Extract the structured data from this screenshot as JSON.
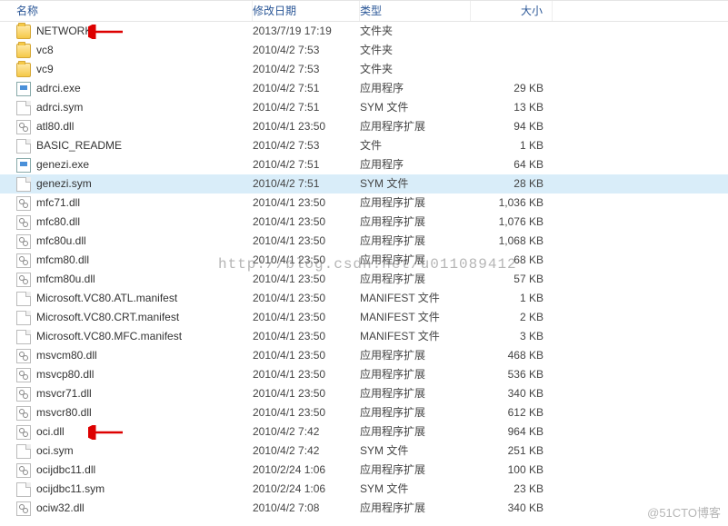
{
  "columns": {
    "name": "名称",
    "date": "修改日期",
    "type": "类型",
    "size": "大小"
  },
  "watermark_center": "http://blog.csdn.net/u011089412",
  "watermark_corner": "@51CTO博客",
  "files": [
    {
      "name": "NETWORK",
      "date": "2013/7/19 17:19",
      "type": "文件夹",
      "size": "",
      "icon": "folder",
      "annotated": true
    },
    {
      "name": "vc8",
      "date": "2010/4/2 7:53",
      "type": "文件夹",
      "size": "",
      "icon": "folder"
    },
    {
      "name": "vc9",
      "date": "2010/4/2 7:53",
      "type": "文件夹",
      "size": "",
      "icon": "folder"
    },
    {
      "name": "adrci.exe",
      "date": "2010/4/2 7:51",
      "type": "应用程序",
      "size": "29 KB",
      "icon": "exe"
    },
    {
      "name": "adrci.sym",
      "date": "2010/4/2 7:51",
      "type": "SYM 文件",
      "size": "13 KB",
      "icon": "file"
    },
    {
      "name": "atl80.dll",
      "date": "2010/4/1 23:50",
      "type": "应用程序扩展",
      "size": "94 KB",
      "icon": "dll"
    },
    {
      "name": "BASIC_README",
      "date": "2010/4/2 7:53",
      "type": "文件",
      "size": "1 KB",
      "icon": "file"
    },
    {
      "name": "genezi.exe",
      "date": "2010/4/2 7:51",
      "type": "应用程序",
      "size": "64 KB",
      "icon": "exe"
    },
    {
      "name": "genezi.sym",
      "date": "2010/4/2 7:51",
      "type": "SYM 文件",
      "size": "28 KB",
      "icon": "file",
      "selected": true
    },
    {
      "name": "mfc71.dll",
      "date": "2010/4/1 23:50",
      "type": "应用程序扩展",
      "size": "1,036 KB",
      "icon": "dll"
    },
    {
      "name": "mfc80.dll",
      "date": "2010/4/1 23:50",
      "type": "应用程序扩展",
      "size": "1,076 KB",
      "icon": "dll"
    },
    {
      "name": "mfc80u.dll",
      "date": "2010/4/1 23:50",
      "type": "应用程序扩展",
      "size": "1,068 KB",
      "icon": "dll"
    },
    {
      "name": "mfcm80.dll",
      "date": "2010/4/1 23:50",
      "type": "应用程序扩展",
      "size": "68 KB",
      "icon": "dll"
    },
    {
      "name": "mfcm80u.dll",
      "date": "2010/4/1 23:50",
      "type": "应用程序扩展",
      "size": "57 KB",
      "icon": "dll"
    },
    {
      "name": "Microsoft.VC80.ATL.manifest",
      "date": "2010/4/1 23:50",
      "type": "MANIFEST 文件",
      "size": "1 KB",
      "icon": "file"
    },
    {
      "name": "Microsoft.VC80.CRT.manifest",
      "date": "2010/4/1 23:50",
      "type": "MANIFEST 文件",
      "size": "2 KB",
      "icon": "file"
    },
    {
      "name": "Microsoft.VC80.MFC.manifest",
      "date": "2010/4/1 23:50",
      "type": "MANIFEST 文件",
      "size": "3 KB",
      "icon": "file"
    },
    {
      "name": "msvcm80.dll",
      "date": "2010/4/1 23:50",
      "type": "应用程序扩展",
      "size": "468 KB",
      "icon": "dll"
    },
    {
      "name": "msvcp80.dll",
      "date": "2010/4/1 23:50",
      "type": "应用程序扩展",
      "size": "536 KB",
      "icon": "dll"
    },
    {
      "name": "msvcr71.dll",
      "date": "2010/4/1 23:50",
      "type": "应用程序扩展",
      "size": "340 KB",
      "icon": "dll"
    },
    {
      "name": "msvcr80.dll",
      "date": "2010/4/1 23:50",
      "type": "应用程序扩展",
      "size": "612 KB",
      "icon": "dll"
    },
    {
      "name": "oci.dll",
      "date": "2010/4/2 7:42",
      "type": "应用程序扩展",
      "size": "964 KB",
      "icon": "dll",
      "annotated": true
    },
    {
      "name": "oci.sym",
      "date": "2010/4/2 7:42",
      "type": "SYM 文件",
      "size": "251 KB",
      "icon": "file"
    },
    {
      "name": "ocijdbc11.dll",
      "date": "2010/2/24 1:06",
      "type": "应用程序扩展",
      "size": "100 KB",
      "icon": "dll"
    },
    {
      "name": "ocijdbc11.sym",
      "date": "2010/2/24 1:06",
      "type": "SYM 文件",
      "size": "23 KB",
      "icon": "file"
    },
    {
      "name": "ociw32.dll",
      "date": "2010/4/2 7:08",
      "type": "应用程序扩展",
      "size": "340 KB",
      "icon": "dll"
    }
  ]
}
